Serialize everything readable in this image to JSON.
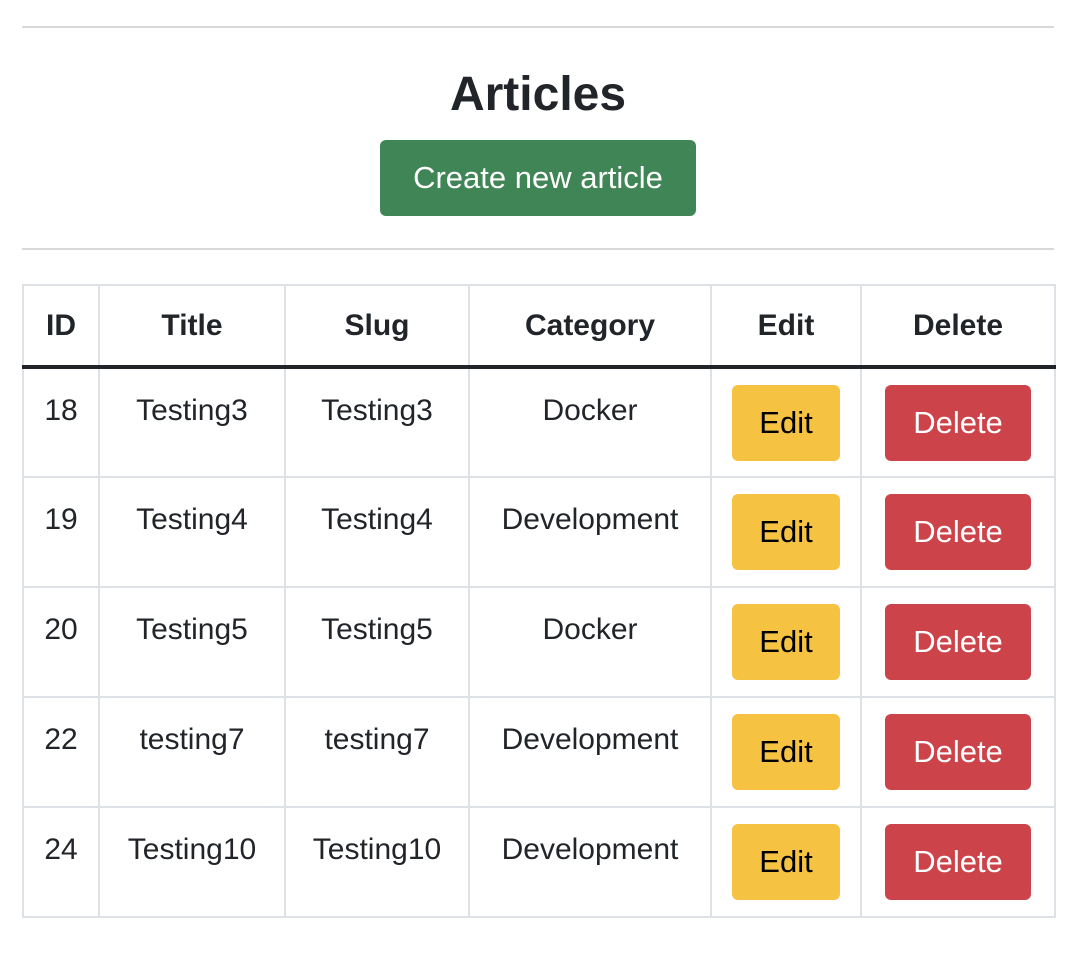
{
  "page": {
    "title": "Articles",
    "create_button_label": "Create new article"
  },
  "colors": {
    "create_button": "#408555",
    "edit_button": "#f5c242",
    "delete_button": "#cc434a"
  },
  "table": {
    "headers": [
      "ID",
      "Title",
      "Slug",
      "Category",
      "Edit",
      "Delete"
    ],
    "rows": [
      {
        "id": "18",
        "title": "Testing3",
        "slug": "Testing3",
        "category": "Docker",
        "edit_label": "Edit",
        "delete_label": "Delete"
      },
      {
        "id": "19",
        "title": "Testing4",
        "slug": "Testing4",
        "category": "Development",
        "edit_label": "Edit",
        "delete_label": "Delete"
      },
      {
        "id": "20",
        "title": "Testing5",
        "slug": "Testing5",
        "category": "Docker",
        "edit_label": "Edit",
        "delete_label": "Delete"
      },
      {
        "id": "22",
        "title": "testing7",
        "slug": "testing7",
        "category": "Development",
        "edit_label": "Edit",
        "delete_label": "Delete"
      },
      {
        "id": "24",
        "title": "Testing10",
        "slug": "Testing10",
        "category": "Development",
        "edit_label": "Edit",
        "delete_label": "Delete"
      }
    ]
  }
}
